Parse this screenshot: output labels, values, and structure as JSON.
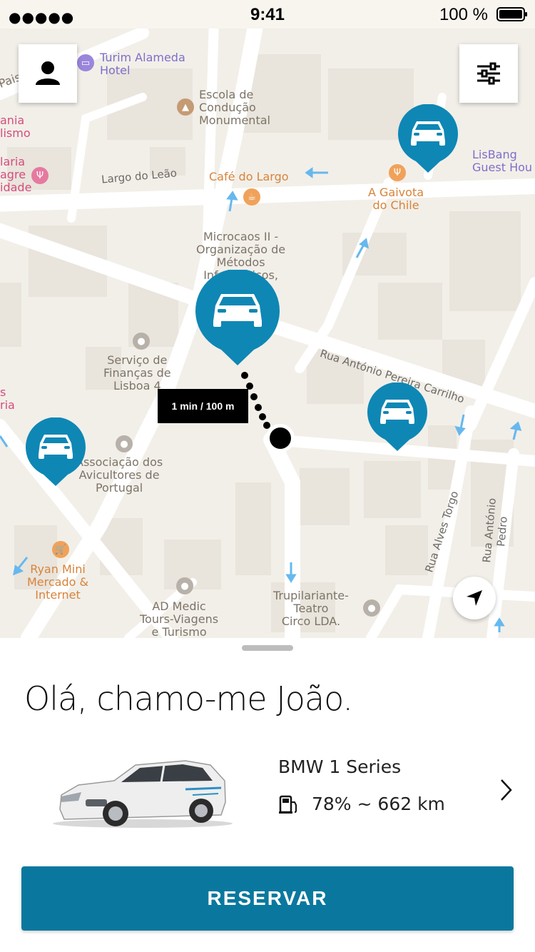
{
  "status_bar": {
    "signal": "●●●●●",
    "time": "9:41",
    "battery": "100 %"
  },
  "map": {
    "labels": {
      "turim": "Turim Alameda\nHotel",
      "escola": "Escola de\nCondução\nMonumental",
      "lisbang": "LisBang\nGuest Hou",
      "cafe": "Café do Largo",
      "gaivota": "A Gaivota\ndo Chile",
      "microcaos": "Microcaos II -\nOrganização de\nMétodos\nInformáticos,",
      "servico": "Serviço de\nFinanças de\nLisboa 4",
      "associacao": "Associação dos\nAvicultores de\nPortugal",
      "ryan": "Ryan Mini\nMercado &\nInternet",
      "admedic": "AD Medic\nTours-Viagens\ne Turismo",
      "trupilariante": "Trupilariante-\nTeatro\nCirco LDA.",
      "largo_leao": "Largo do Leão",
      "rua_pereira": "Rua António Pereira Carrilho",
      "rua_torgo": "Rua Alves Torgo",
      "rua_pedro": "Rua António Pedro",
      "pais": "Pais",
      "left_top": "ania\nlismo",
      "left_mid": "laria\nagre\nidade",
      "left_low": "s\nria"
    },
    "walk_tooltip": "1 min / 100 m"
  },
  "sheet": {
    "greeting": "Olá, chamo-me João.",
    "car_model": "BMW 1 Series",
    "fuel_info": "78% ~ 662 km",
    "reserve_label": "RESERVAR"
  },
  "colors": {
    "accent": "#0a789e",
    "pin_blue": "#0e87b5"
  }
}
